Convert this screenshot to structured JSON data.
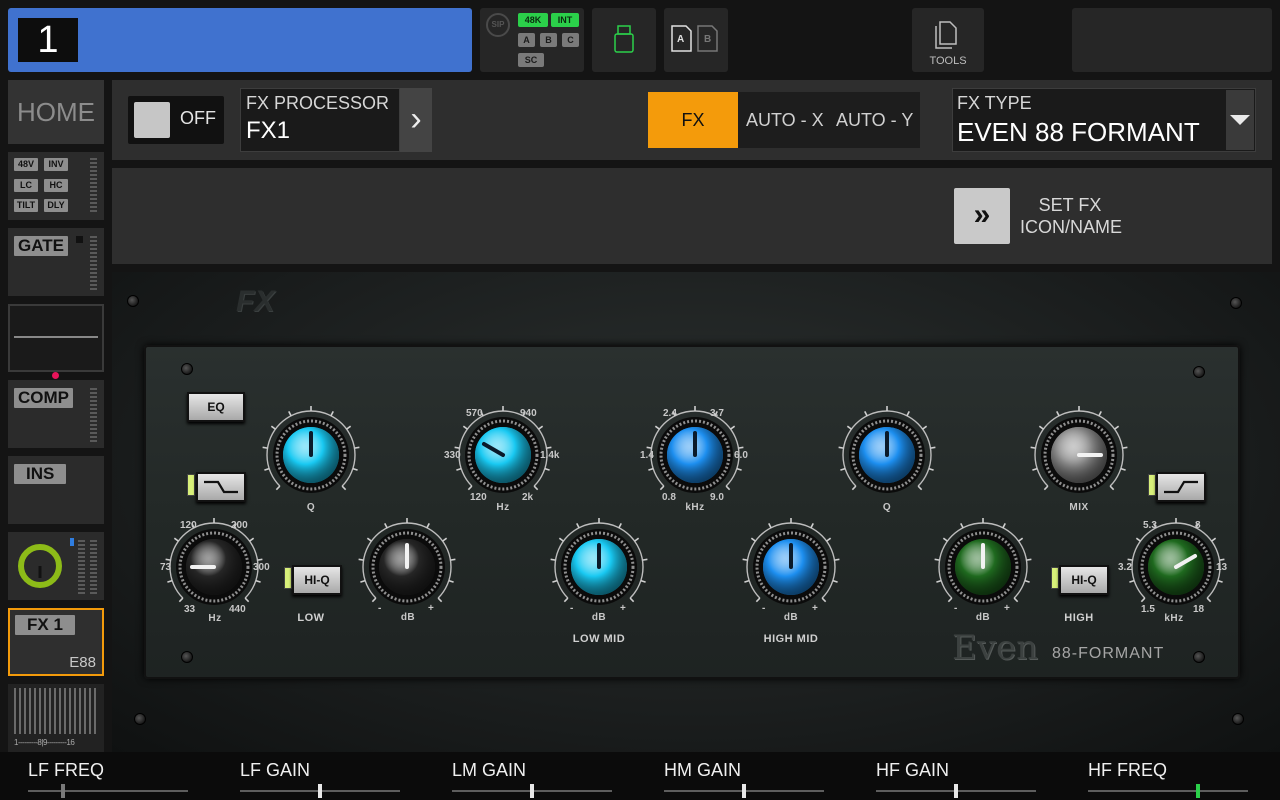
{
  "channel": {
    "number": "1"
  },
  "status": {
    "sip": "SIP",
    "rate": "48K",
    "clock": "INT",
    "a": "A",
    "b": "B",
    "c": "C",
    "sc": "SC"
  },
  "card": {
    "a": "A",
    "b": "B"
  },
  "tools": {
    "label": "TOOLS"
  },
  "sidebar": {
    "home": "HOME",
    "preamp_tags": [
      "48V",
      "INV",
      "LC",
      "HC",
      "TILT",
      "DLY"
    ],
    "gate": "GATE",
    "comp": "COMP",
    "ins": "INS",
    "fx": {
      "label": "FX 1",
      "sub": "E88"
    },
    "meter_scale": "1---------8|9---------16"
  },
  "fx_header": {
    "toggle_label": "OFF",
    "processor_caption": "FX PROCESSOR",
    "processor_value": "FX1",
    "modes": [
      "FX",
      "AUTO - X",
      "AUTO - Y"
    ],
    "active_mode": "FX",
    "type_caption": "FX TYPE",
    "type_value": "EVEN 88 FORMANT",
    "set_line1": "SET FX",
    "set_line2": "ICON/NAME"
  },
  "plugin": {
    "logo": "FX",
    "brand": "Even",
    "model": "88-FORMANT",
    "buttons": {
      "eq": "EQ",
      "hiq_low": "HI-Q",
      "hiq_high": "HI-Q"
    },
    "sections": {
      "low": "LOW",
      "low_mid": "LOW MID",
      "high_mid": "HIGH MID",
      "high": "HIGH"
    },
    "knobs": {
      "lf_q": {
        "label": "Q"
      },
      "lm_freq": {
        "label": "Hz",
        "ticks": [
          "570",
          "940",
          "330",
          "1.4k",
          "120",
          "2k"
        ]
      },
      "hm_freq": {
        "label": "kHz",
        "ticks": [
          "2.4",
          "3.7",
          "1.4",
          "6.0",
          "0.8",
          "9.0"
        ]
      },
      "hm_q": {
        "label": "Q"
      },
      "mix": {
        "label": "MIX"
      },
      "lf_freq": {
        "label": "Hz",
        "ticks": [
          "120",
          "200",
          "73",
          "300",
          "33",
          "440"
        ]
      },
      "lf_gain": {
        "label": "dB",
        "minus": "-",
        "plus": "+"
      },
      "lm_gain": {
        "label": "dB",
        "minus": "-",
        "plus": "+"
      },
      "hm_gain": {
        "label": "dB",
        "minus": "-",
        "plus": "+"
      },
      "hf_gain": {
        "label": "dB",
        "minus": "-",
        "plus": "+"
      },
      "hf_freq": {
        "label": "kHz",
        "ticks": [
          "5.3",
          "8",
          "3.2",
          "13",
          "1.5",
          "18"
        ]
      }
    }
  },
  "bottom": {
    "params": [
      {
        "label": "LF FREQ",
        "value": 0.22
      },
      {
        "label": "LF GAIN",
        "value": 0.5
      },
      {
        "label": "LM GAIN",
        "value": 0.5
      },
      {
        "label": "HM GAIN",
        "value": 0.5
      },
      {
        "label": "HF GAIN",
        "value": 0.5
      },
      {
        "label": "HF FREQ",
        "value": 0.69
      }
    ]
  },
  "colors": {
    "channel": "#4072cf",
    "accent": "#f49b0b",
    "cyan_knob": "#19c9f2",
    "blue_knob": "#1d8ff0",
    "green_knob": "#1f6a1f",
    "grey_knob": "#8a8a8a",
    "dark_knob": "#262626"
  }
}
